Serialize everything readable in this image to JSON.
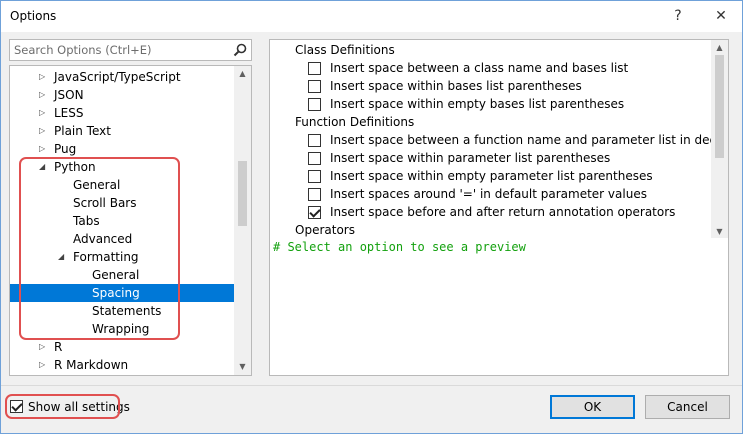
{
  "window": {
    "title": "Options",
    "help_glyph": "?",
    "close_glyph": "✕"
  },
  "search": {
    "placeholder": "Search Options (Ctrl+E)"
  },
  "tree": {
    "items": [
      {
        "label": "JavaScript/TypeScript",
        "level": 0,
        "expander": "collapsed"
      },
      {
        "label": "JSON",
        "level": 0,
        "expander": "collapsed"
      },
      {
        "label": "LESS",
        "level": 0,
        "expander": "collapsed"
      },
      {
        "label": "Plain Text",
        "level": 0,
        "expander": "collapsed"
      },
      {
        "label": "Pug",
        "level": 0,
        "expander": "collapsed"
      },
      {
        "label": "Python",
        "level": 0,
        "expander": "expanded"
      },
      {
        "label": "General",
        "level": 1,
        "expander": "none"
      },
      {
        "label": "Scroll Bars",
        "level": 1,
        "expander": "none"
      },
      {
        "label": "Tabs",
        "level": 1,
        "expander": "none"
      },
      {
        "label": "Advanced",
        "level": 1,
        "expander": "none"
      },
      {
        "label": "Formatting",
        "level": 1,
        "expander": "expanded"
      },
      {
        "label": "General",
        "level": 2,
        "expander": "none"
      },
      {
        "label": "Spacing",
        "level": 2,
        "expander": "none",
        "selected": true
      },
      {
        "label": "Statements",
        "level": 2,
        "expander": "none"
      },
      {
        "label": "Wrapping",
        "level": 2,
        "expander": "none"
      },
      {
        "label": "R",
        "level": 0,
        "expander": "collapsed"
      },
      {
        "label": "R Markdown",
        "level": 0,
        "expander": "collapsed"
      }
    ]
  },
  "options": {
    "groups": [
      {
        "header": "Class Definitions",
        "items": [
          {
            "label": "Insert space between a class name and bases list",
            "checked": false
          },
          {
            "label": "Insert space within bases list parentheses",
            "checked": false
          },
          {
            "label": "Insert space within empty bases list parentheses",
            "checked": false
          }
        ]
      },
      {
        "header": "Function Definitions",
        "items": [
          {
            "label": "Insert space between a function name and parameter list in declarations",
            "checked": false
          },
          {
            "label": "Insert space within parameter list parentheses",
            "checked": false
          },
          {
            "label": "Insert space within empty parameter list parentheses",
            "checked": false
          },
          {
            "label": "Insert spaces around '=' in default parameter values",
            "checked": false
          },
          {
            "label": "Insert space before and after return annotation operators",
            "checked": true
          }
        ]
      },
      {
        "header": "Operators",
        "items": []
      }
    ]
  },
  "preview": {
    "text": "# Select an option to see a preview"
  },
  "footer": {
    "show_all_label": "Show all settings",
    "show_all_checked": true,
    "ok_label": "OK",
    "cancel_label": "Cancel"
  },
  "colors": {
    "selection": "#0078d7",
    "highlight_outline": "#e05050",
    "preview_text": "#13a10e"
  }
}
